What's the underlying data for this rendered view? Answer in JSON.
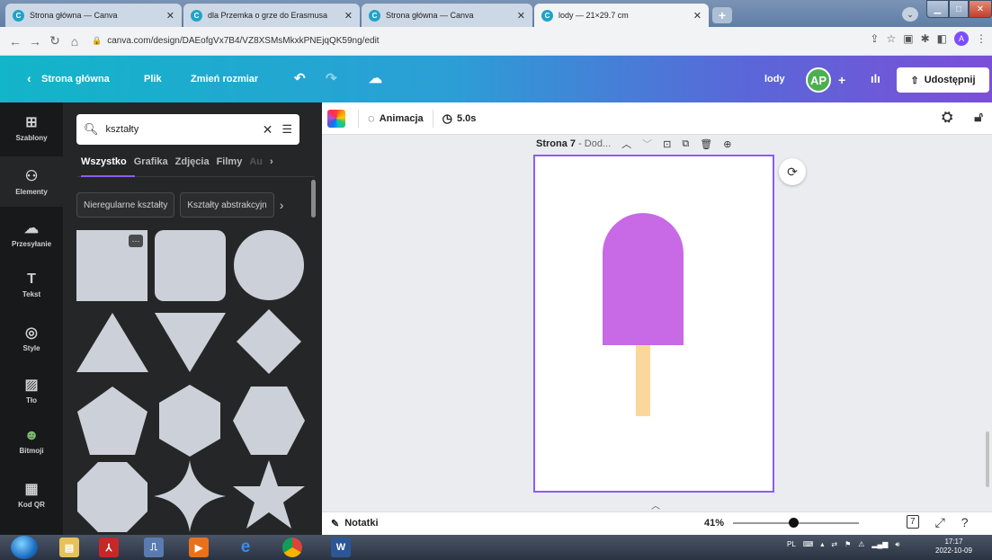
{
  "browser": {
    "tabs": [
      {
        "title": "Strona główna — Canva",
        "active": false
      },
      {
        "title": "dla Przemka o grze do Erasmusa",
        "active": false
      },
      {
        "title": "Strona główna — Canva",
        "active": false
      },
      {
        "title": "lody — 21×29.7 cm",
        "active": true
      }
    ],
    "url": "canva.com/design/DAEofgVx7B4/VZ8XSMsMkxkPNEjqQK59ng/edit",
    "profile_initial": "A"
  },
  "header": {
    "back_label": "Strona główna",
    "file_label": "Plik",
    "resize_label": "Zmień rozmiar",
    "design_title": "lody",
    "user_initials": "AP",
    "share_label": "Udostępnij",
    "colors": {
      "gradient_start": "#12b5c9",
      "gradient_end": "#7b4fd8"
    }
  },
  "rail": [
    {
      "label": "Szablony",
      "icon": "templates-icon"
    },
    {
      "label": "Elementy",
      "icon": "elements-icon",
      "active": true
    },
    {
      "label": "Przesyłanie",
      "icon": "upload-icon"
    },
    {
      "label": "Tekst",
      "icon": "text-icon"
    },
    {
      "label": "Style",
      "icon": "palette-icon"
    },
    {
      "label": "Tło",
      "icon": "background-icon"
    },
    {
      "label": "Bitmoji",
      "icon": "bitmoji-icon"
    },
    {
      "label": "Kod QR",
      "icon": "qr-code-icon"
    }
  ],
  "panel": {
    "search_value": "kształty",
    "categories": [
      "Wszystko",
      "Grafika",
      "Zdjęcia",
      "Filmy",
      "Au"
    ],
    "active_category": "Wszystko",
    "chips": [
      "Nieregularne kształty",
      "Kształty abstrakcyjn"
    ],
    "shape_color": "#ccd1d9",
    "more_label": "···"
  },
  "toolbar": {
    "animation_label": "Animacja",
    "duration": "5.0s"
  },
  "page": {
    "title": "Strona 7",
    "subtitle": "- Dod...",
    "popsicle_color": "#c869e6",
    "stick_color": "#fcd79b"
  },
  "status": {
    "notes_label": "Notatki",
    "zoom": "41%",
    "zoom_fraction": 0.48,
    "page_count": "7"
  },
  "taskbar": {
    "language": "PL",
    "time": "17:17",
    "date": "2022-10-09"
  }
}
